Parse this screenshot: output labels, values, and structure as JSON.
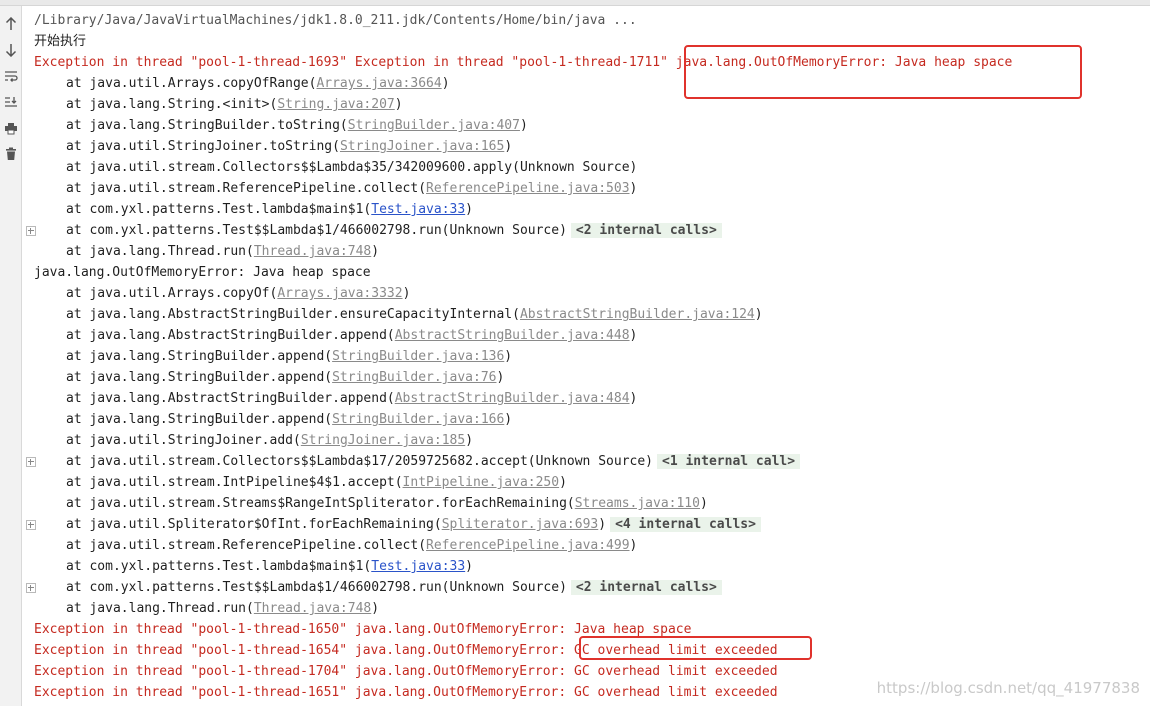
{
  "header_line": "/Library/Java/JavaVirtualMachines/jdk1.8.0_211.jdk/Contents/Home/bin/java ...",
  "status_line": "开始执行",
  "gutter_icons": [
    "up-arrow-icon",
    "down-arrow-icon",
    "soft-wrap-icon",
    "scroll-to-end-icon",
    "print-icon",
    "trash-icon"
  ],
  "lines": [
    {
      "kind": "error",
      "segments": [
        {
          "t": "Exception in thread \"pool-1-thread-1693\" Exception in thread \"pool-1-thread-1711\" java.lang.OutOfMemoryError: Java heap space"
        }
      ]
    },
    {
      "kind": "frame",
      "segments": [
        {
          "t": "at java.util.Arrays.copyOfRange("
        },
        {
          "t": "Arrays.java:3664",
          "link": true
        },
        {
          "t": ")"
        }
      ]
    },
    {
      "kind": "frame",
      "segments": [
        {
          "t": "at java.lang.String.<init>("
        },
        {
          "t": "String.java:207",
          "link": true
        },
        {
          "t": ")"
        }
      ]
    },
    {
      "kind": "frame",
      "segments": [
        {
          "t": "at java.lang.StringBuilder.toString("
        },
        {
          "t": "StringBuilder.java:407",
          "link": true
        },
        {
          "t": ")"
        }
      ]
    },
    {
      "kind": "frame",
      "segments": [
        {
          "t": "at java.util.StringJoiner.toString("
        },
        {
          "t": "StringJoiner.java:165",
          "link": true
        },
        {
          "t": ")"
        }
      ]
    },
    {
      "kind": "frame",
      "segments": [
        {
          "t": "at java.util.stream.Collectors$$Lambda$35/342009600.apply(Unknown Source)"
        }
      ]
    },
    {
      "kind": "frame",
      "segments": [
        {
          "t": "at java.util.stream.ReferencePipeline.collect("
        },
        {
          "t": "ReferencePipeline.java:503",
          "link": true
        },
        {
          "t": ")"
        }
      ]
    },
    {
      "kind": "frame",
      "segments": [
        {
          "t": "at com.yxl.patterns.Test.lambda$main$1("
        },
        {
          "t": "Test.java:33",
          "link": true,
          "blue": true
        },
        {
          "t": ")"
        }
      ]
    },
    {
      "kind": "frame",
      "expand": true,
      "segments": [
        {
          "t": "at com.yxl.patterns.Test$$Lambda$1/466002798.run(Unknown Source)"
        },
        {
          "t": "<2 internal calls>",
          "fold": true
        }
      ]
    },
    {
      "kind": "frame",
      "segments": [
        {
          "t": "at java.lang.Thread.run("
        },
        {
          "t": "Thread.java:748",
          "link": true
        },
        {
          "t": ")"
        }
      ]
    },
    {
      "kind": "plain",
      "segments": [
        {
          "t": "java.lang.OutOfMemoryError: Java heap space"
        }
      ]
    },
    {
      "kind": "frame",
      "segments": [
        {
          "t": "at java.util.Arrays.copyOf("
        },
        {
          "t": "Arrays.java:3332",
          "link": true
        },
        {
          "t": ")"
        }
      ]
    },
    {
      "kind": "frame",
      "segments": [
        {
          "t": "at java.lang.AbstractStringBuilder.ensureCapacityInternal("
        },
        {
          "t": "AbstractStringBuilder.java:124",
          "link": true
        },
        {
          "t": ")"
        }
      ]
    },
    {
      "kind": "frame",
      "segments": [
        {
          "t": "at java.lang.AbstractStringBuilder.append("
        },
        {
          "t": "AbstractStringBuilder.java:448",
          "link": true
        },
        {
          "t": ")"
        }
      ]
    },
    {
      "kind": "frame",
      "segments": [
        {
          "t": "at java.lang.StringBuilder.append("
        },
        {
          "t": "StringBuilder.java:136",
          "link": true
        },
        {
          "t": ")"
        }
      ]
    },
    {
      "kind": "frame",
      "segments": [
        {
          "t": "at java.lang.StringBuilder.append("
        },
        {
          "t": "StringBuilder.java:76",
          "link": true
        },
        {
          "t": ")"
        }
      ]
    },
    {
      "kind": "frame",
      "segments": [
        {
          "t": "at java.lang.AbstractStringBuilder.append("
        },
        {
          "t": "AbstractStringBuilder.java:484",
          "link": true
        },
        {
          "t": ")"
        }
      ]
    },
    {
      "kind": "frame",
      "segments": [
        {
          "t": "at java.lang.StringBuilder.append("
        },
        {
          "t": "StringBuilder.java:166",
          "link": true
        },
        {
          "t": ")"
        }
      ]
    },
    {
      "kind": "frame",
      "segments": [
        {
          "t": "at java.util.StringJoiner.add("
        },
        {
          "t": "StringJoiner.java:185",
          "link": true
        },
        {
          "t": ")"
        }
      ]
    },
    {
      "kind": "frame",
      "expand": true,
      "segments": [
        {
          "t": "at java.util.stream.Collectors$$Lambda$17/2059725682.accept(Unknown Source)"
        },
        {
          "t": "<1 internal call>",
          "fold": true
        }
      ]
    },
    {
      "kind": "frame",
      "segments": [
        {
          "t": "at java.util.stream.IntPipeline$4$1.accept("
        },
        {
          "t": "IntPipeline.java:250",
          "link": true
        },
        {
          "t": ")"
        }
      ]
    },
    {
      "kind": "frame",
      "segments": [
        {
          "t": "at java.util.stream.Streams$RangeIntSpliterator.forEachRemaining("
        },
        {
          "t": "Streams.java:110",
          "link": true
        },
        {
          "t": ")"
        }
      ]
    },
    {
      "kind": "frame",
      "expand": true,
      "segments": [
        {
          "t": "at java.util.Spliterator$OfInt.forEachRemaining("
        },
        {
          "t": "Spliterator.java:693",
          "link": true
        },
        {
          "t": ")"
        },
        {
          "t": "<4 internal calls>",
          "fold": true
        }
      ]
    },
    {
      "kind": "frame",
      "segments": [
        {
          "t": "at java.util.stream.ReferencePipeline.collect("
        },
        {
          "t": "ReferencePipeline.java:499",
          "link": true
        },
        {
          "t": ")"
        }
      ]
    },
    {
      "kind": "frame",
      "segments": [
        {
          "t": "at com.yxl.patterns.Test.lambda$main$1("
        },
        {
          "t": "Test.java:33",
          "link": true,
          "blue": true
        },
        {
          "t": ")"
        }
      ]
    },
    {
      "kind": "frame",
      "expand": true,
      "segments": [
        {
          "t": "at com.yxl.patterns.Test$$Lambda$1/466002798.run(Unknown Source)"
        },
        {
          "t": "<2 internal calls>",
          "fold": true
        }
      ]
    },
    {
      "kind": "frame",
      "segments": [
        {
          "t": "at java.lang.Thread.run("
        },
        {
          "t": "Thread.java:748",
          "link": true
        },
        {
          "t": ")"
        }
      ]
    },
    {
      "kind": "error",
      "segments": [
        {
          "t": "Exception in thread \"pool-1-thread-1650\" java.lang.OutOfMemoryError: Java heap space"
        }
      ]
    },
    {
      "kind": "error",
      "segments": [
        {
          "t": "Exception in thread \"pool-1-thread-1654\" java.lang.OutOfMemoryError: GC overhead limit exceeded"
        }
      ]
    },
    {
      "kind": "error",
      "segments": [
        {
          "t": "Exception in thread \"pool-1-thread-1704\" java.lang.OutOfMemoryError: GC overhead limit exceeded"
        }
      ]
    },
    {
      "kind": "error",
      "segments": [
        {
          "t": "Exception in thread \"pool-1-thread-1651\" java.lang.OutOfMemoryError: GC overhead limit exceeded"
        }
      ]
    }
  ],
  "watermark": "https://blog.csdn.net/qq_41977838",
  "colors": {
    "error_text": "#c52a20",
    "highlight_box": "#e0322c",
    "link_gray": "#8a8a8a",
    "link_blue": "#2a53c9",
    "fold_bg": "#eaf3ea"
  }
}
